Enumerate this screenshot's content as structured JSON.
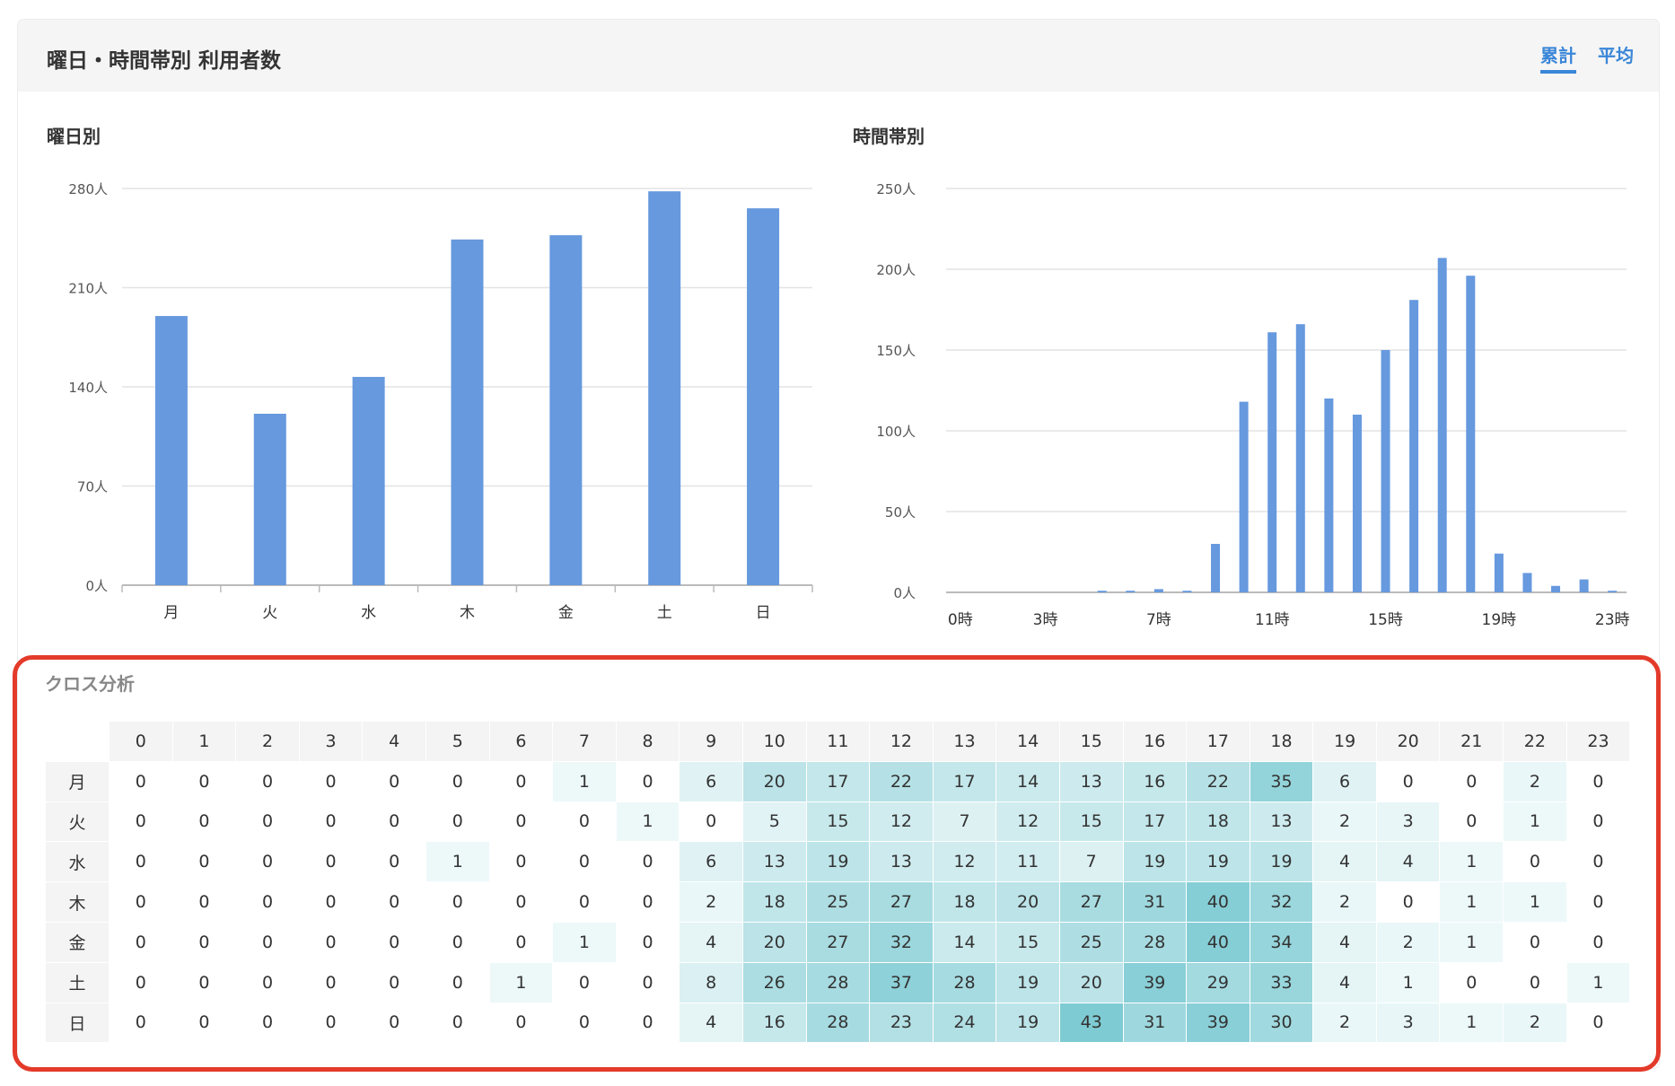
{
  "header": {
    "title": "曜日・時間帯別 利用者数",
    "tabs": [
      {
        "label": "累計",
        "active": true
      },
      {
        "label": "平均",
        "active": false
      }
    ]
  },
  "colors": {
    "bar": "#6699de",
    "accent": "#3a86d8",
    "highlight_border": "#e33a2a",
    "heat_low": "#ffffff",
    "heat_high": "#7ecbd3"
  },
  "weekday_chart": {
    "title": "曜日別"
  },
  "hour_chart": {
    "title": "時間帯別"
  },
  "chart_data": [
    {
      "type": "bar",
      "title": "曜日別",
      "categories": [
        "月",
        "火",
        "水",
        "木",
        "金",
        "土",
        "日"
      ],
      "values": [
        190,
        121,
        147,
        244,
        247,
        278,
        266
      ],
      "ylim": [
        0,
        280
      ],
      "yticks": [
        "0人",
        "70人",
        "140人",
        "210人",
        "280人"
      ],
      "grid": true
    },
    {
      "type": "bar",
      "title": "時間帯別",
      "categories": [
        "0時",
        "1時",
        "2時",
        "3時",
        "4時",
        "5時",
        "6時",
        "7時",
        "8時",
        "9時",
        "10時",
        "11時",
        "12時",
        "13時",
        "14時",
        "15時",
        "16時",
        "17時",
        "18時",
        "19時",
        "20時",
        "21時",
        "22時",
        "23時"
      ],
      "xtick_labels_shown": [
        "0時",
        "3時",
        "7時",
        "11時",
        "15時",
        "19時",
        "23時"
      ],
      "values": [
        0,
        0,
        0,
        0,
        0,
        1,
        1,
        2,
        1,
        30,
        118,
        161,
        166,
        120,
        110,
        150,
        181,
        207,
        196,
        24,
        12,
        4,
        8,
        1
      ],
      "ylim": [
        0,
        250
      ],
      "yticks": [
        "0人",
        "50人",
        "100人",
        "150人",
        "200人",
        "250人"
      ],
      "grid": true
    },
    {
      "type": "heatmap",
      "title": "クロス分析",
      "columns": [
        "0",
        "1",
        "2",
        "3",
        "4",
        "5",
        "6",
        "7",
        "8",
        "9",
        "10",
        "11",
        "12",
        "13",
        "14",
        "15",
        "16",
        "17",
        "18",
        "19",
        "20",
        "21",
        "22",
        "23"
      ],
      "rows": [
        "月",
        "火",
        "水",
        "木",
        "金",
        "土",
        "日"
      ],
      "values": [
        [
          0,
          0,
          0,
          0,
          0,
          0,
          0,
          1,
          0,
          6,
          20,
          17,
          22,
          17,
          14,
          13,
          16,
          22,
          35,
          6,
          0,
          0,
          2,
          0
        ],
        [
          0,
          0,
          0,
          0,
          0,
          0,
          0,
          0,
          1,
          0,
          5,
          15,
          12,
          7,
          12,
          15,
          17,
          18,
          13,
          2,
          3,
          0,
          1,
          0
        ],
        [
          0,
          0,
          0,
          0,
          0,
          1,
          0,
          0,
          0,
          6,
          13,
          19,
          13,
          12,
          11,
          7,
          19,
          19,
          19,
          4,
          4,
          1,
          0,
          0
        ],
        [
          0,
          0,
          0,
          0,
          0,
          0,
          0,
          0,
          0,
          2,
          18,
          25,
          27,
          18,
          20,
          27,
          31,
          40,
          32,
          2,
          0,
          1,
          1,
          0
        ],
        [
          0,
          0,
          0,
          0,
          0,
          0,
          0,
          1,
          0,
          4,
          20,
          27,
          32,
          14,
          15,
          25,
          28,
          40,
          34,
          4,
          2,
          1,
          0,
          0
        ],
        [
          0,
          0,
          0,
          0,
          0,
          0,
          1,
          0,
          0,
          8,
          26,
          28,
          37,
          28,
          19,
          20,
          39,
          29,
          33,
          4,
          1,
          0,
          0,
          1
        ],
        [
          0,
          0,
          0,
          0,
          0,
          0,
          0,
          0,
          0,
          4,
          16,
          28,
          23,
          24,
          19,
          43,
          31,
          39,
          30,
          2,
          3,
          1,
          2,
          0
        ]
      ],
      "max": 43
    }
  ]
}
